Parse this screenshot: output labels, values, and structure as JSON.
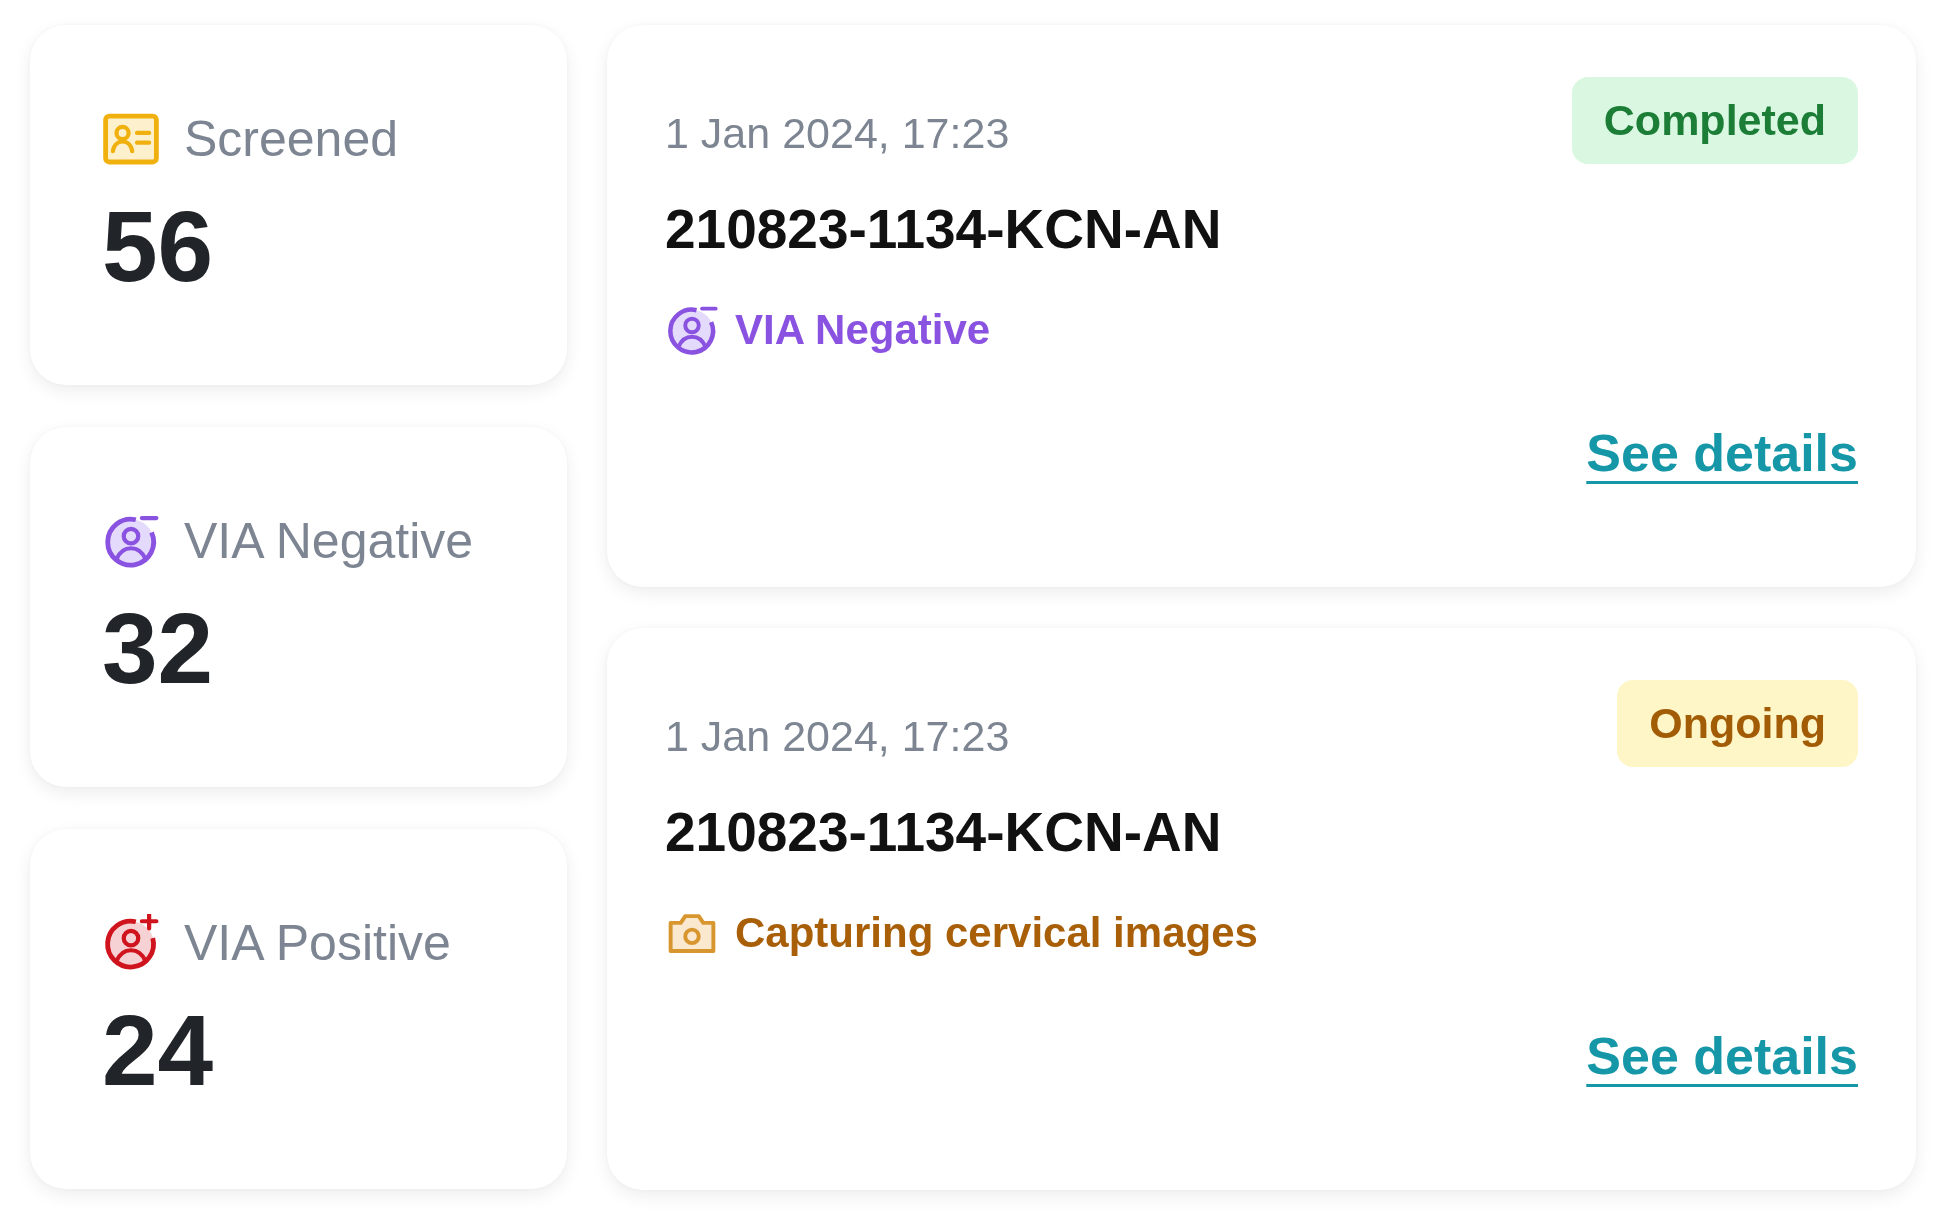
{
  "stats": [
    {
      "kind": "screened",
      "label": "Screened",
      "value": "56"
    },
    {
      "kind": "negative",
      "label": "VIA Negative",
      "value": "32"
    },
    {
      "kind": "positive",
      "label": "VIA Positive",
      "value": "24"
    }
  ],
  "screenings": [
    {
      "date": "1 Jan 2024, 17:23",
      "status": {
        "kind": "completed",
        "label": "Completed"
      },
      "id": "210823-1134-KCN-AN",
      "result": {
        "kind": "negative",
        "label": "VIA Negative"
      },
      "link": "See details"
    },
    {
      "date": "1 Jan 2024, 17:23",
      "status": {
        "kind": "ongoing",
        "label": "Ongoing"
      },
      "id": "210823-1134-KCN-AN",
      "result": {
        "kind": "capturing",
        "label": "Capturing cervical images"
      },
      "link": "See details"
    }
  ]
}
